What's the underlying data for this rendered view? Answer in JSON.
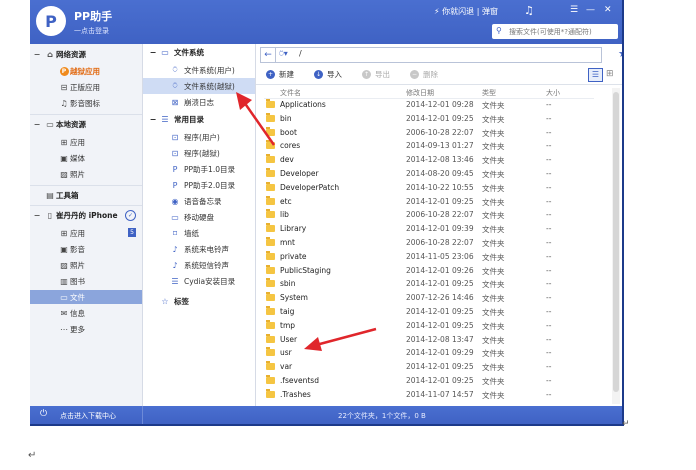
{
  "titlebar": {
    "app_title": "PP助手",
    "subtitle": "一点击登录",
    "share_text": "你就闪退 | 弹窗",
    "search_placeholder": "搜索文件(可使用*?通配符)",
    "minimize_glyph": "—",
    "close_glyph": "✕",
    "logo_letter": "P"
  },
  "left_panel": {
    "groups": [
      {
        "label": "网络资源",
        "items": [
          {
            "label": "越狱应用",
            "icon": "p-icon"
          },
          {
            "label": "正版应用",
            "icon": "app-icon"
          },
          {
            "label": "影音图标",
            "icon": "music-icon"
          }
        ]
      },
      {
        "label": "本地资源",
        "items": [
          {
            "label": "应用",
            "icon": "grid-icon"
          },
          {
            "label": "媒体",
            "icon": "film-icon"
          },
          {
            "label": "照片",
            "icon": "photo-icon"
          }
        ]
      },
      {
        "label": "工具箱",
        "items": []
      },
      {
        "label": "崔丹丹的 iPhone",
        "items": [
          {
            "label": "应用",
            "icon": "grid-icon",
            "badge": "5"
          },
          {
            "label": "影音",
            "icon": "film-icon"
          },
          {
            "label": "照片",
            "icon": "photo-icon"
          },
          {
            "label": "图书",
            "icon": "book-icon"
          },
          {
            "label": "文件",
            "icon": "folder-icon",
            "selected": true
          },
          {
            "label": "信息",
            "icon": "message-icon"
          },
          {
            "label": "更多",
            "icon": "more-icon"
          }
        ]
      }
    ]
  },
  "middle_panel": {
    "fs_header": "文件系统",
    "fs_items": [
      {
        "label": "文件系统(用户)"
      },
      {
        "label": "文件系统(越狱)",
        "selected": true
      },
      {
        "label": "崩溃日志"
      }
    ],
    "common_header": "常用目录",
    "common_items": [
      {
        "label": "程序(用户)"
      },
      {
        "label": "程序(越狱)"
      },
      {
        "label": "PP助手1.0目录"
      },
      {
        "label": "PP助手2.0目录"
      },
      {
        "label": "语音备忘录"
      },
      {
        "label": "移动硬盘"
      },
      {
        "label": "墙纸"
      },
      {
        "label": "系统来电铃声"
      },
      {
        "label": "系统短信铃声"
      },
      {
        "label": "Cydia安装目录"
      }
    ],
    "tags_header": "标签"
  },
  "file_panel": {
    "path": "/",
    "toolbar": {
      "new": "新建",
      "import": "导入",
      "export": "导出",
      "delete": "删除"
    },
    "columns": {
      "name": "文件名",
      "date": "修改日期",
      "type": "类型",
      "size": "大小"
    },
    "rows": [
      {
        "name": "Applications",
        "date": "2014-12-01 09:28",
        "type": "文件夹",
        "size": "--"
      },
      {
        "name": "bin",
        "date": "2014-12-01 09:25",
        "type": "文件夹",
        "size": "--"
      },
      {
        "name": "boot",
        "date": "2006-10-28 22:07",
        "type": "文件夹",
        "size": "--"
      },
      {
        "name": "cores",
        "date": "2014-09-13 01:27",
        "type": "文件夹",
        "size": "--"
      },
      {
        "name": "dev",
        "date": "2014-12-08 13:46",
        "type": "文件夹",
        "size": "--"
      },
      {
        "name": "Developer",
        "date": "2014-08-20 09:45",
        "type": "文件夹",
        "size": "--"
      },
      {
        "name": "DeveloperPatch",
        "date": "2014-10-22 10:55",
        "type": "文件夹",
        "size": "--"
      },
      {
        "name": "etc",
        "date": "2014-12-01 09:25",
        "type": "文件夹",
        "size": "--"
      },
      {
        "name": "lib",
        "date": "2006-10-28 22:07",
        "type": "文件夹",
        "size": "--"
      },
      {
        "name": "Library",
        "date": "2014-12-01 09:39",
        "type": "文件夹",
        "size": "--"
      },
      {
        "name": "mnt",
        "date": "2006-10-28 22:07",
        "type": "文件夹",
        "size": "--"
      },
      {
        "name": "private",
        "date": "2014-11-05 23:06",
        "type": "文件夹",
        "size": "--"
      },
      {
        "name": "PublicStaging",
        "date": "2014-12-01 09:26",
        "type": "文件夹",
        "size": "--"
      },
      {
        "name": "sbin",
        "date": "2014-12-01 09:25",
        "type": "文件夹",
        "size": "--"
      },
      {
        "name": "System",
        "date": "2007-12-26 14:46",
        "type": "文件夹",
        "size": "--"
      },
      {
        "name": "taig",
        "date": "2014-12-01 09:25",
        "type": "文件夹",
        "size": "--"
      },
      {
        "name": "tmp",
        "date": "2014-12-01 09:25",
        "type": "文件夹",
        "size": "--"
      },
      {
        "name": "User",
        "date": "2014-12-08 13:47",
        "type": "文件夹",
        "size": "--"
      },
      {
        "name": "usr",
        "date": "2014-12-01 09:29",
        "type": "文件夹",
        "size": "--"
      },
      {
        "name": "var",
        "date": "2014-12-01 09:25",
        "type": "文件夹",
        "size": "--"
      },
      {
        "name": ".fseventsd",
        "date": "2014-12-01 09:25",
        "type": "文件夹",
        "size": "--"
      },
      {
        "name": ".Trashes",
        "date": "2014-11-07 14:57",
        "type": "文件夹",
        "size": "--"
      }
    ]
  },
  "statusbar": {
    "download_center": "点击进入下载中心",
    "summary": "22个文件夹，1个文件，0 B"
  },
  "colors": {
    "brand": "#3f62c4",
    "selected": "#8ba5dc",
    "accent_orange": "#e26a12",
    "arrow_red": "#e0262b"
  },
  "page_marks": {
    "return_glyph": "↵"
  }
}
